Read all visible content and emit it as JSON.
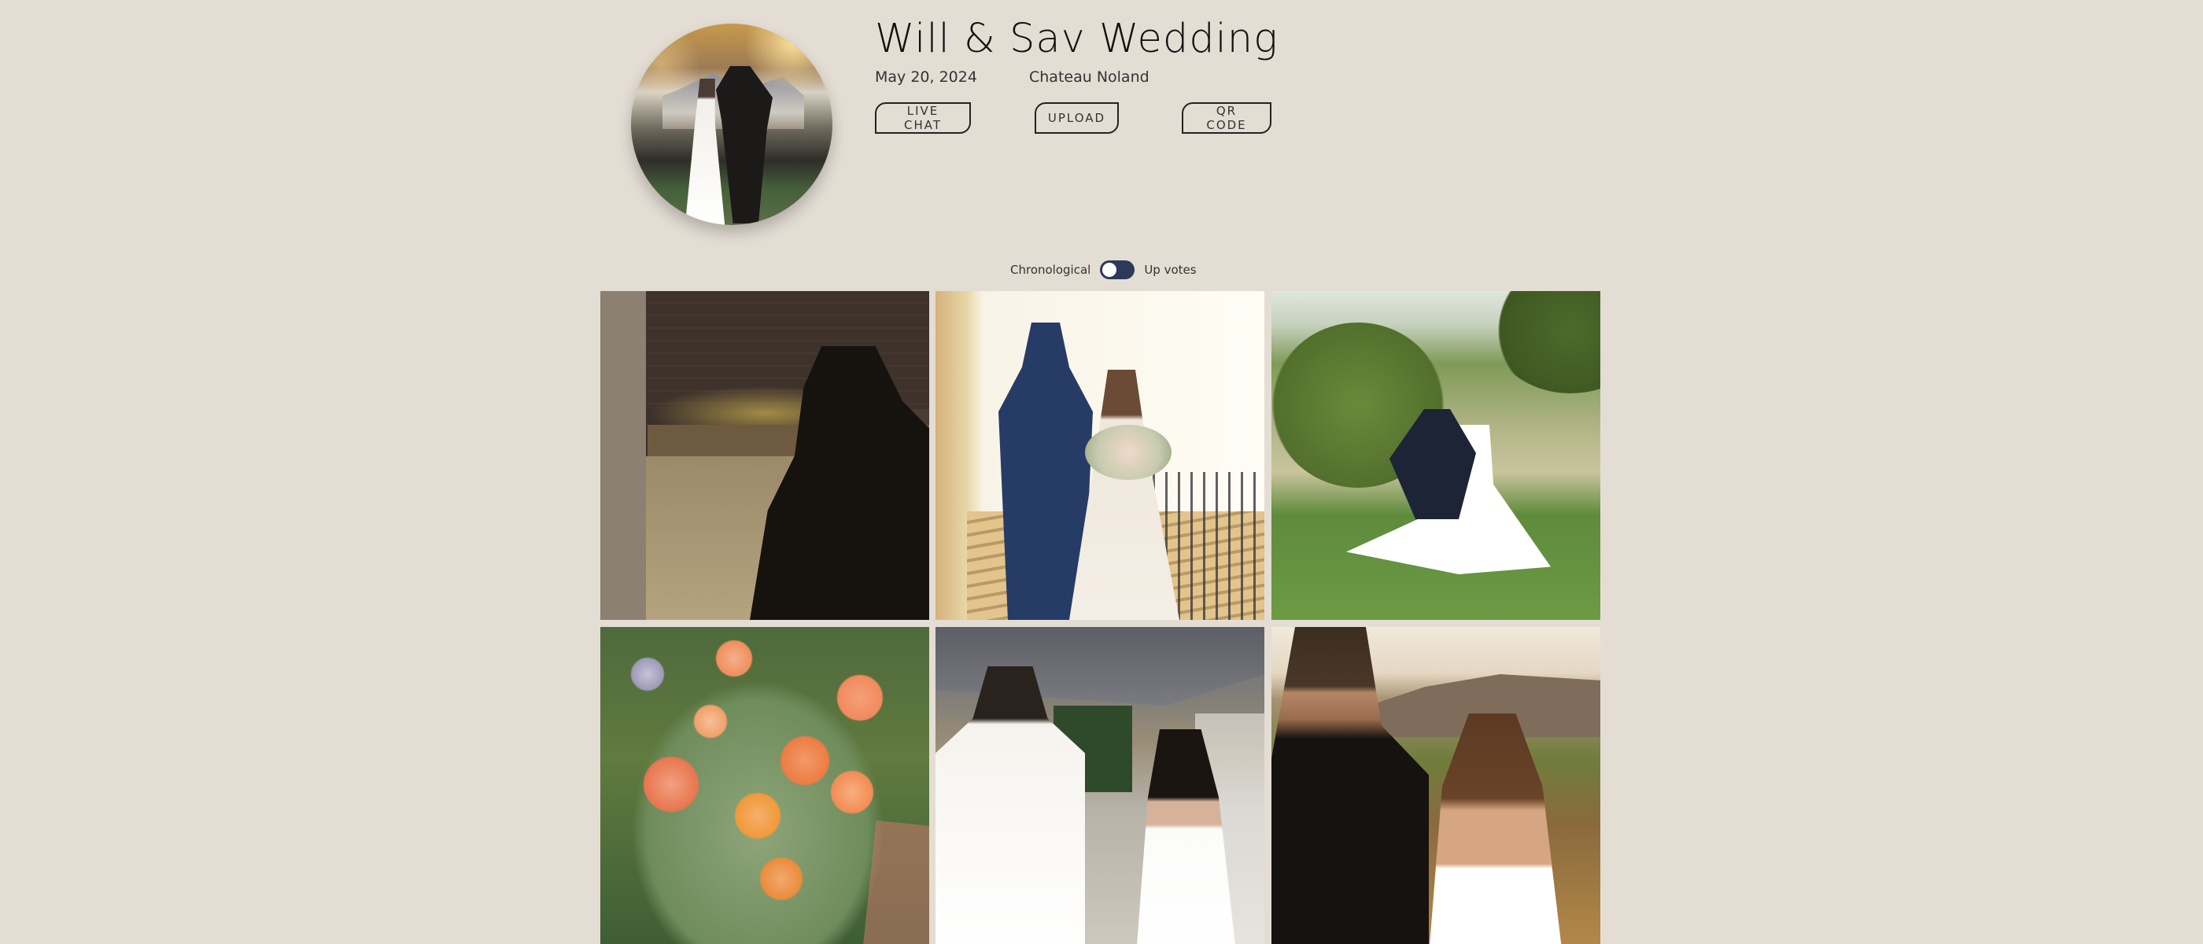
{
  "event": {
    "title": "Will & Sav Wedding",
    "date": "May 20, 2024",
    "venue": "Chateau Noland"
  },
  "actions": {
    "live_chat": "LIVE CHAT",
    "upload": "UPLOAD",
    "qr_code": "QR CODE"
  },
  "sort": {
    "left_label": "Chronological",
    "right_label": "Up votes",
    "mode": "Chronological"
  },
  "colors": {
    "background": "#e4ddd4",
    "toggle": "#2d3a57",
    "text": "#1d1d1d"
  },
  "photos": [
    {
      "subject": "guitarist-performing"
    },
    {
      "subject": "couple-on-staircase"
    },
    {
      "subject": "couple-dip-kiss"
    },
    {
      "subject": "floral-arrangement"
    },
    {
      "subject": "couple-white-attire"
    },
    {
      "subject": "couple-golden-hour"
    }
  ]
}
